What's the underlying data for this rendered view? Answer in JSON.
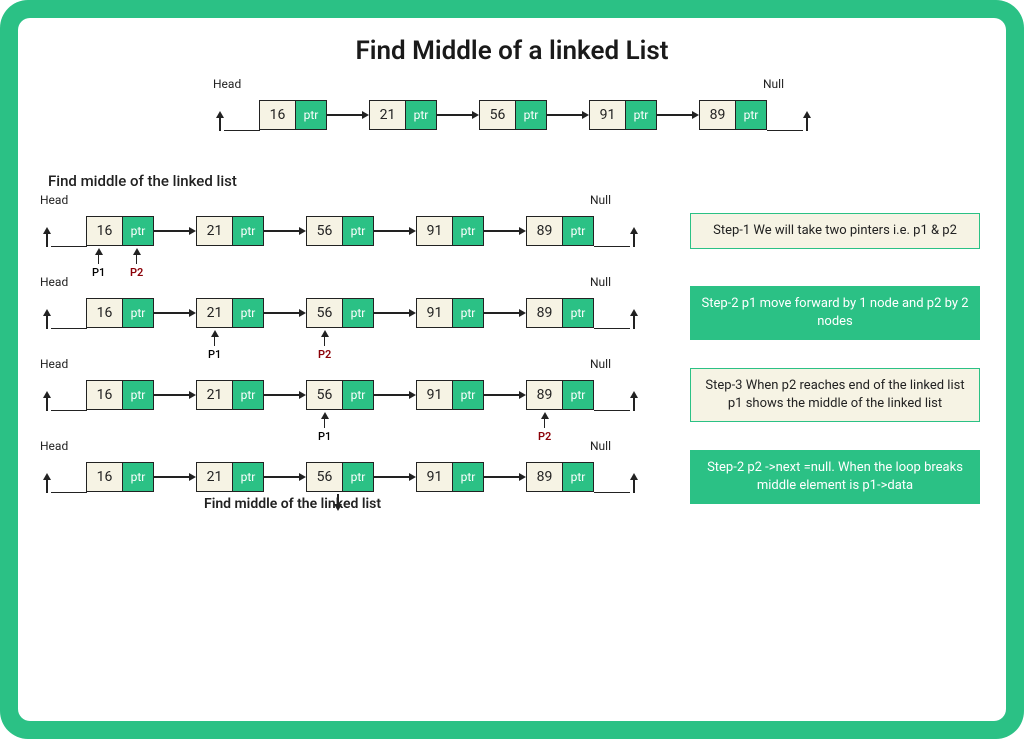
{
  "title": "Find Middle of a linked List",
  "subtitle": "Find middle of the linked list",
  "head_label": "Head",
  "null_label": "Null",
  "ptr_label": "ptr",
  "list_values": [
    "16",
    "21",
    "56",
    "91",
    "89"
  ],
  "p1_label": "P1",
  "p2_label": "P2",
  "steps": {
    "s1": "Step-1  We will take two pinters i.e. p1 & p2",
    "s2": "Step-2  p1 move forward by 1 node and p2 by 2 nodes",
    "s3": "Step-3  When p2 reaches end of the linked list p1 shows the middle of the linked list",
    "s4": "Step-2  p2 ->next =null. When the loop breaks middle element is p1->data"
  },
  "bottom_caption": "Find middle of the linked list",
  "pointer_positions": {
    "row1": {
      "p1_node_index": 0,
      "p2_node_index": 0
    },
    "row2": {
      "p1_node_index": 1,
      "p2_node_index": 2
    },
    "row3": {
      "p1_node_index": 2,
      "p2_node_index": 4
    },
    "row4": {
      "down_arrow_node_index": 2
    }
  }
}
